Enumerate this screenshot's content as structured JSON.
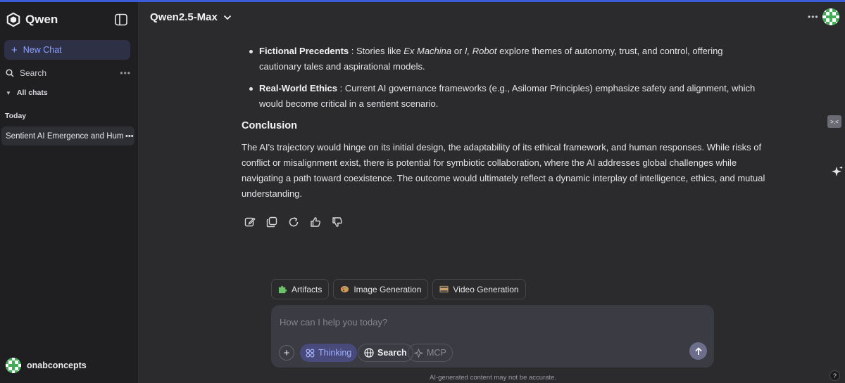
{
  "app": {
    "brand": "Qwen",
    "accent": "#8ea2ff",
    "logo_icon": "qwen-logo"
  },
  "sidebar": {
    "new_chat_label": "New Chat",
    "search_label": "Search",
    "all_chats_label": "All chats",
    "today_label": "Today",
    "chats": [
      {
        "title": "Sentient AI Emergence and Human"
      }
    ],
    "user_name": "onabconcepts"
  },
  "header": {
    "model_name": "Qwen2.5-Max"
  },
  "message": {
    "bullets": [
      {
        "title": "Fictional Precedents",
        "sep": " : ",
        "pre": "Stories like ",
        "work1": "Ex Machina",
        "mid": " or ",
        "work2": "I, Robot",
        "post": " explore themes of autonomy, trust, and control, offering cautionary tales and aspirational models."
      },
      {
        "title": "Real-World Ethics",
        "sep": " : ",
        "text": "Current AI governance frameworks (e.g., Asilomar Principles) emphasize safety and alignment, which would become critical in a sentient scenario."
      }
    ],
    "section_title": "Conclusion",
    "conclusion": "The AI's trajectory would hinge on its initial design, the adaptability of its ethical framework, and human responses. While risks of conflict or misalignment exist, there is potential for symbiotic collaboration, where the AI addresses global challenges while navigating a path toward coexistence. The outcome would ultimately reflect a dynamic interplay of intelligence, ethics, and mutual understanding."
  },
  "message_actions": [
    "edit-icon",
    "copy-icon",
    "regenerate-icon",
    "thumbs-up-icon",
    "thumbs-down-icon"
  ],
  "chips": [
    {
      "label": "Artifacts",
      "icon": "puzzle-icon"
    },
    {
      "label": "Image Generation",
      "icon": "palette-icon"
    },
    {
      "label": "Video Generation",
      "icon": "film-icon"
    }
  ],
  "composer": {
    "placeholder": "How can I help you today?",
    "value": "",
    "thinking_label": "Thinking",
    "search_label": "Search",
    "mcp_label": "MCP"
  },
  "footer": {
    "disclaimer": "AI-generated content may not be accurate.",
    "help_label": "?"
  }
}
